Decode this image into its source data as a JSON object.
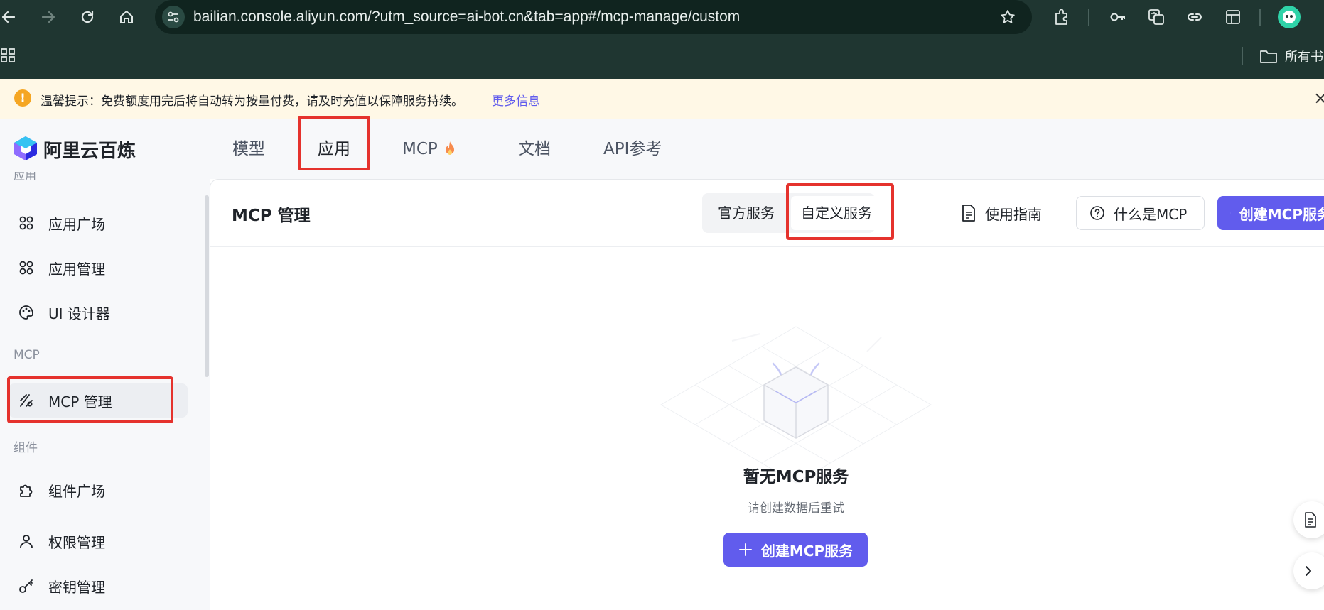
{
  "browser": {
    "url": "bailian.console.aliyun.com/?utm_source=ai-bot.cn&tab=app#/mcp-manage/custom",
    "bookmark_folder": "所有书"
  },
  "notice": {
    "text": "温馨提示：免费额度用完后将自动转为按量付费，请及时充值以保障服务持续。",
    "link": "更多信息",
    "icon_char": "!",
    "close_char": "×"
  },
  "header": {
    "brand": "阿里云百炼",
    "tabs": [
      {
        "label": "模型"
      },
      {
        "label": "应用"
      },
      {
        "label": "MCP"
      },
      {
        "label": "文档"
      },
      {
        "label": "API参考"
      }
    ],
    "active_tab": "应用"
  },
  "sidebar": {
    "partial_label": "应用",
    "items": [
      {
        "label": "应用广场",
        "icon": "apps-icon"
      },
      {
        "label": "应用管理",
        "icon": "apps-icon"
      },
      {
        "label": "UI 设计器",
        "icon": "palette-icon"
      },
      {
        "label": "MCP 管理",
        "icon": "mcp-icon"
      },
      {
        "label": "组件广场",
        "icon": "puzzle-icon"
      },
      {
        "label": "权限管理",
        "icon": "user-icon"
      },
      {
        "label": "密钥管理",
        "icon": "key-icon"
      }
    ],
    "groups": [
      "MCP",
      "组件"
    ],
    "active_item": "MCP 管理"
  },
  "main": {
    "title": "MCP 管理",
    "segments": [
      {
        "label": "官方服务"
      },
      {
        "label": "自定义服务"
      }
    ],
    "active_segment": "自定义服务",
    "guide_button": "使用指南",
    "what_button": "什么是MCP",
    "create_button_top": "创建MCP服务",
    "empty": {
      "title": "暂无MCP服务",
      "subtitle": "请创建数据后重试",
      "button": "创建MCP服务"
    }
  },
  "colors": {
    "brand": "#615ced",
    "annotation": "#e5322d",
    "chrome": "#1f3631",
    "notice_bg": "#fff8e6"
  }
}
